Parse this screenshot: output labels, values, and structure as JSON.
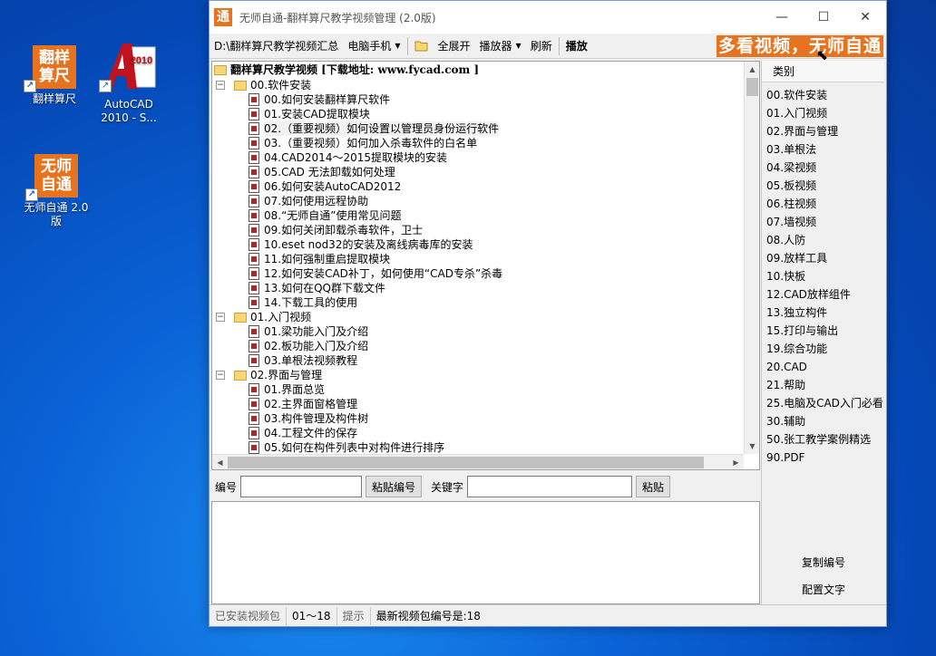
{
  "desktop": {
    "icons": [
      {
        "label": "翻样算尺",
        "tile": [
          "翻样",
          "算尺"
        ]
      },
      {
        "label": "AutoCAD 2010 - S...",
        "tile_year": "2010"
      },
      {
        "label": "无师自通 2.0 版",
        "tile": [
          "无师",
          "自通"
        ]
      }
    ]
  },
  "window": {
    "app_icon_char": "通",
    "title": "无师自通-翻样算尺教学视频管理 (2.0版)",
    "controls": {
      "minimize": "—",
      "maximize": "☐",
      "close": "✕"
    }
  },
  "toolbar": {
    "path": "D:\\翻样算尺教学视频汇总",
    "computer_phone": "电脑手机",
    "expand_all": "全展开",
    "player": "播放器",
    "refresh": "刷新",
    "play": "播放",
    "banner": "多看视频，无师自通"
  },
  "tree": {
    "root": "翻样算尺教学视频 [下载地址: www.fycad.com ]",
    "groups": [
      {
        "label": "00.软件安装",
        "items": [
          "00.如何安装翻样算尺软件",
          "01.安装CAD提取模块",
          "02.（重要视频）如何设置以管理员身份运行软件",
          "03.（重要视频）如何加入杀毒软件的白名单",
          "04.CAD2014～2015提取模块的安装",
          "05.CAD 无法卸载如何处理",
          "06.如何安装AutoCAD2012",
          "07.如何使用远程协助",
          "08.“无师自通”使用常见问题",
          "09.如何关闭卸载杀毒软件，卫士",
          "10.eset nod32的安装及离线病毒库的安装",
          "11.如何强制重启提取模块",
          "12.如何安装CAD补丁，如何使用“CAD专杀”杀毒",
          "13.如何在QQ群下载文件",
          "14.下载工具的使用"
        ]
      },
      {
        "label": "01.入门视频",
        "items": [
          "01.梁功能入门及介绍",
          "02.板功能入门及介绍",
          "03.单根法视频教程"
        ]
      },
      {
        "label": "02.界面与管理",
        "items": [
          "01.界面总览",
          "02.主界面窗格管理",
          "03.构件管理及构件树",
          "04.工程文件的保存",
          "05.如何在构件列表中对构件进行排序"
        ]
      }
    ]
  },
  "search": {
    "number_label": "编号",
    "number_value": "",
    "paste_number": "粘贴编号",
    "keyword_label": "关键字",
    "keyword_value": "",
    "paste": "粘贴"
  },
  "categories": {
    "header": "类别",
    "items": [
      "00.软件安装",
      "01.入门视频",
      "02.界面与管理",
      "03.单根法",
      "04.梁视频",
      "05.板视频",
      "06.柱视频",
      "07.墙视频",
      "08.人防",
      "09.放样工具",
      "10.快板",
      "12.CAD放样组件",
      "13.独立构件",
      "15.打印与输出",
      "19.综合功能",
      "20.CAD",
      "21.帮助",
      "25.电脑及CAD入门必看",
      "30.辅助",
      "50.张工教学案例精选",
      "90.PDF"
    ],
    "copy_number": "复制编号",
    "config_text": "配置文字"
  },
  "status": {
    "installed": "已安装视频包",
    "range": "01～18",
    "hint": "提示",
    "latest": "最新视频包编号是:18"
  },
  "colors": {
    "brand_orange": "#e8731f",
    "desktop_blue": "#0a63d6"
  }
}
